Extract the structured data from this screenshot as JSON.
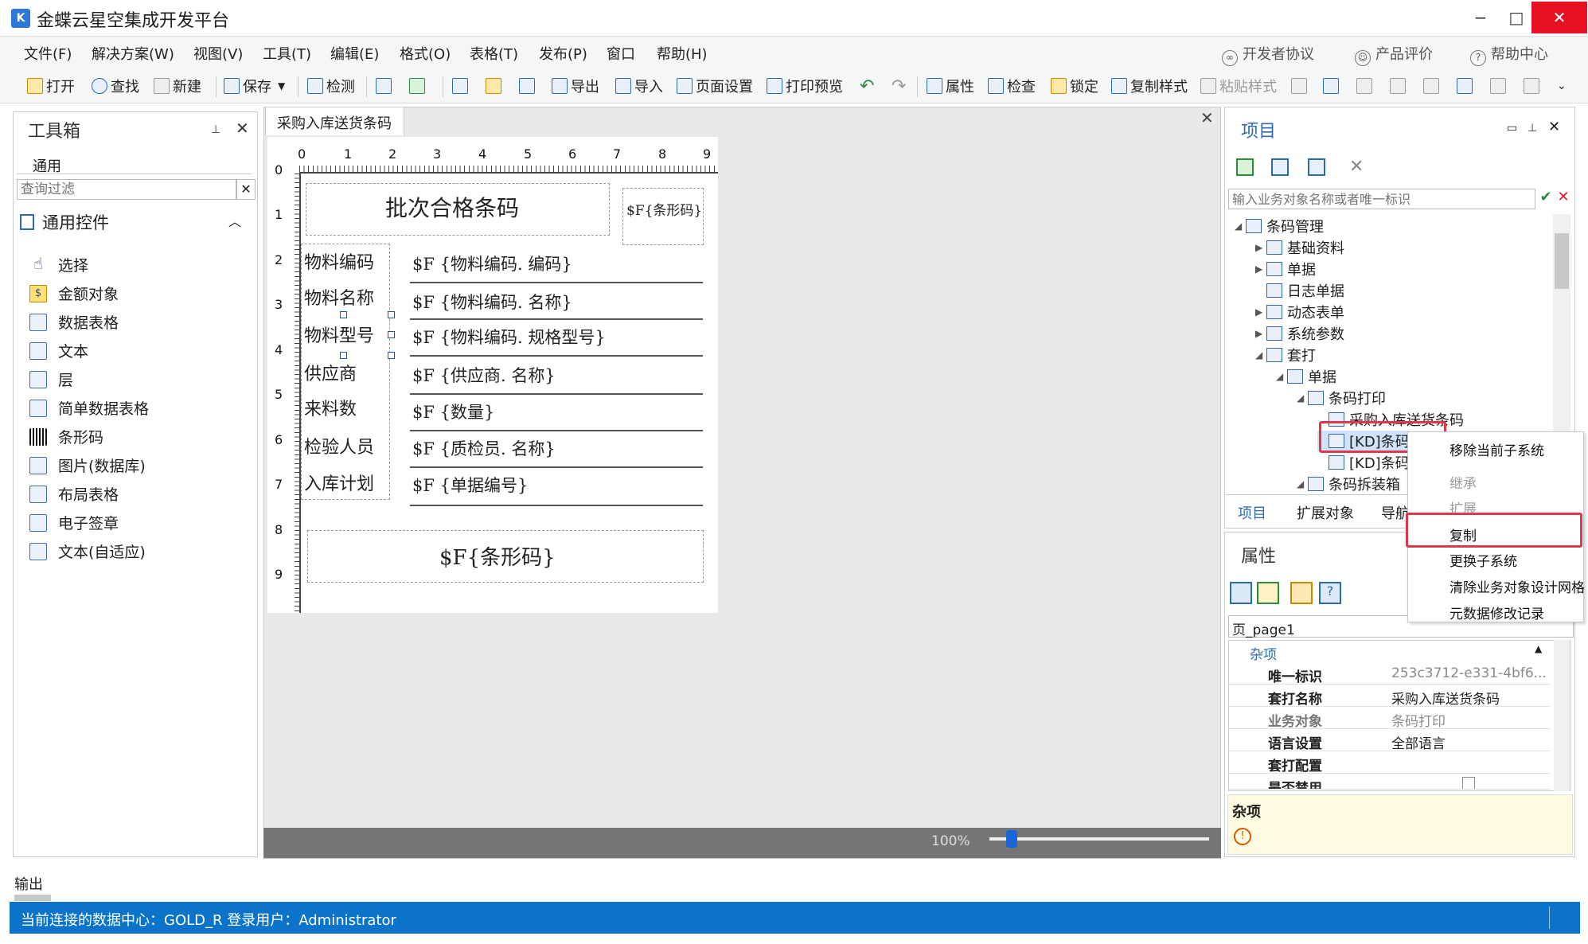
{
  "window": {
    "title": "金蝶云星空集成开发平台",
    "minimize": "−",
    "maximize": "□",
    "close": "✕"
  },
  "menu": {
    "items": [
      "文件(F)",
      "解决方案(W)",
      "视图(V)",
      "工具(T)",
      "编辑(E)",
      "格式(O)",
      "表格(T)",
      "发布(P)",
      "窗口",
      "帮助(H)"
    ],
    "right": [
      "开发者协议",
      "产品评价",
      "帮助中心"
    ]
  },
  "toolbar": {
    "open": "打开",
    "find": "查找",
    "new": "新建",
    "save": "保存",
    "check": "检测",
    "export": "导出",
    "import": "导入",
    "page_setup": "页面设置",
    "print_preview": "打印预览",
    "properties": "属性",
    "inspect": "检查",
    "lock": "锁定",
    "copy_style": "复制样式",
    "paste_style": "粘贴样式"
  },
  "toolbox": {
    "title": "工具箱",
    "category": "通用",
    "filter_placeholder": "查询过滤",
    "group": "通用控件",
    "items": [
      "选择",
      "金额对象",
      "数据表格",
      "文本",
      "层",
      "简单数据表格",
      "条形码",
      "图片(数据库)",
      "布局表格",
      "电子签章",
      "文本(自适应)"
    ]
  },
  "document": {
    "tab": "采购入库送货条码",
    "ruler_top": [
      "0",
      "1",
      "2",
      "3",
      "4",
      "5",
      "6",
      "7",
      "8",
      "9"
    ],
    "ruler_left": [
      "0",
      "1",
      "2",
      "3",
      "4",
      "5",
      "6",
      "7",
      "8",
      "9"
    ],
    "title": "批次合格条码",
    "barcode_small": "$F{条形码}",
    "rows": [
      {
        "label": "物料编码",
        "field": "$F {物料编码. 编码}"
      },
      {
        "label": "物料名称",
        "field": "$F {物料编码. 名称}"
      },
      {
        "label": "物料型号",
        "field": "$F {物料编码. 规格型号}"
      },
      {
        "label": "供应商",
        "field": "$F {供应商. 名称}"
      },
      {
        "label": "来料数",
        "field": "$F {数量}"
      },
      {
        "label": "检验人员",
        "field": "$F {质检员. 名称}"
      },
      {
        "label": "入库计划",
        "field": "$F {单据编号}"
      }
    ],
    "barcode_big": "$F{条形码}",
    "zoom": "100%",
    "zoom_level": 0.1
  },
  "project": {
    "title": "项目",
    "search_placeholder": "输入业务对象名称或者唯一标识",
    "tree": [
      {
        "label": "条码管理",
        "depth": 0,
        "arrow": "◢"
      },
      {
        "label": "基础资料",
        "depth": 1,
        "arrow": "▶"
      },
      {
        "label": "单据",
        "depth": 1,
        "arrow": "▶"
      },
      {
        "label": "日志单据",
        "depth": 1,
        "arrow": ""
      },
      {
        "label": "动态表单",
        "depth": 1,
        "arrow": "▶"
      },
      {
        "label": "系统参数",
        "depth": 1,
        "arrow": "▶"
      },
      {
        "label": "套打",
        "depth": 1,
        "arrow": "◢"
      },
      {
        "label": "单据",
        "depth": 2,
        "arrow": "◢"
      },
      {
        "label": "条码打印",
        "depth": 3,
        "arrow": "◢"
      },
      {
        "label": "采购入库送货条码",
        "depth": 4,
        "arrow": ""
      },
      {
        "label": "[KD]条码",
        "depth": 4,
        "arrow": ""
      },
      {
        "label": "[KD]条码",
        "depth": 4,
        "arrow": ""
      },
      {
        "label": "条码拆装箱",
        "depth": 3,
        "arrow": "◢"
      }
    ],
    "tabs": [
      "项目",
      "扩展对象",
      "导航"
    ]
  },
  "context_menu": {
    "items": [
      "移除当前子系统",
      "继承",
      "扩展",
      "复制",
      "更换子系统",
      "清除业务对象设计网格",
      "元数据修改记录"
    ]
  },
  "properties": {
    "title": "属性",
    "object": "页_page1",
    "section": "杂项",
    "rows": [
      {
        "name": "唯一标识",
        "value": "253c3712-e331-4bf6...",
        "gray": true
      },
      {
        "name": "套打名称",
        "value": "采购入库送货条码",
        "gray": false
      },
      {
        "name": "业务对象",
        "value": "条码打印",
        "gray": true
      },
      {
        "name": "语言设置",
        "value": "全部语言",
        "gray": false
      },
      {
        "name": "套打配置",
        "value": "",
        "gray": false
      },
      {
        "name": "是否禁用",
        "value": "",
        "gray": false
      }
    ],
    "desc_title": "杂项"
  },
  "output": {
    "tab": "输出"
  },
  "status": {
    "text": "当前连接的数据中心：GOLD_R  登录用户：Administrator"
  }
}
